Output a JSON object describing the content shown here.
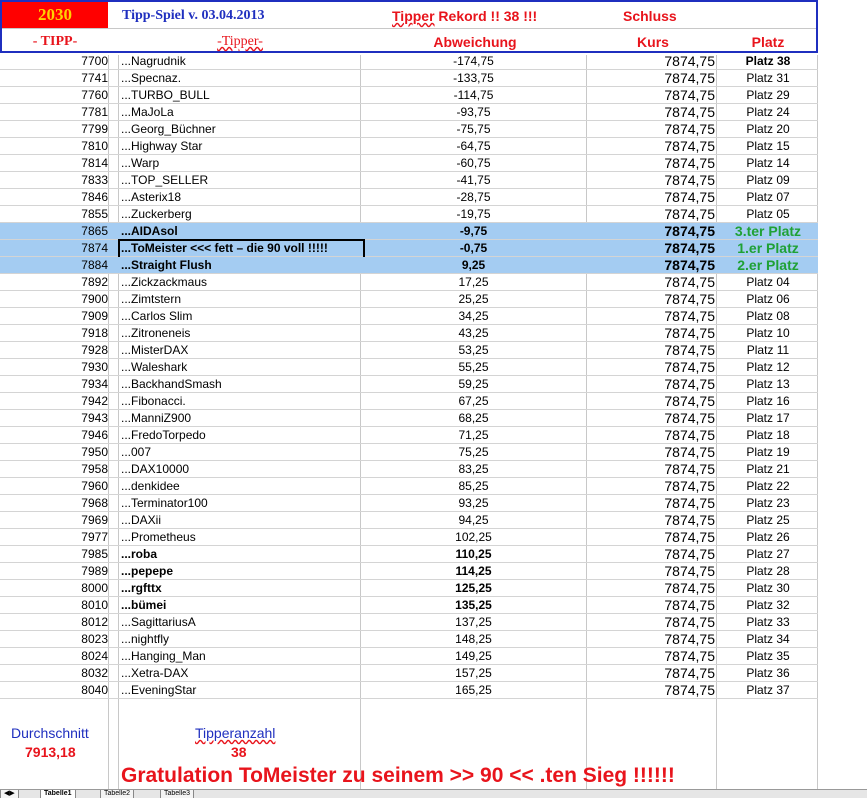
{
  "header": {
    "year": "2030",
    "year_bg": "#ff0000",
    "version": "Tipp-Spiel v. 03.04.2013",
    "rekord_prefix": "Tipper",
    "rekord_rest": "Rekord !!  38  !!!",
    "schluss": "Schluss",
    "col_tipp": "- TIPP-",
    "col_tipper": "-Tipper-",
    "col_abweichung": "Abweichung",
    "col_kurs": "Kurs",
    "col_platz": "Platz",
    "border_color": "#1f2fbf",
    "label_red": "#e8141c",
    "label_blue": "#1f2fbf"
  },
  "rows": [
    {
      "tipp": "7700",
      "name": "...Nagrudnik",
      "dev": "-174,75",
      "kurs": "7874,75",
      "platz": "Platz 38",
      "platz_bold": true
    },
    {
      "tipp": "7741",
      "name": "...Specnaz.",
      "dev": "-133,75",
      "kurs": "7874,75",
      "platz": "Platz 31"
    },
    {
      "tipp": "7760",
      "name": "...TURBO_BULL",
      "dev": "-114,75",
      "kurs": "7874,75",
      "platz": "Platz 29"
    },
    {
      "tipp": "7781",
      "name": "...MaJoLa",
      "dev": "-93,75",
      "kurs": "7874,75",
      "platz": "Platz 24"
    },
    {
      "tipp": "7799",
      "name": "...Georg_Büchner",
      "dev": "-75,75",
      "kurs": "7874,75",
      "platz": "Platz 20"
    },
    {
      "tipp": "7810",
      "name": "...Highway Star",
      "dev": "-64,75",
      "kurs": "7874,75",
      "platz": "Platz 15"
    },
    {
      "tipp": "7814",
      "name": "...Warp",
      "dev": "-60,75",
      "kurs": "7874,75",
      "platz": "Platz 14"
    },
    {
      "tipp": "7833",
      "name": "...TOP_SELLER",
      "dev": "-41,75",
      "kurs": "7874,75",
      "platz": "Platz 09"
    },
    {
      "tipp": "7846",
      "name": "...Asterix18",
      "dev": "-28,75",
      "kurs": "7874,75",
      "platz": "Platz 07"
    },
    {
      "tipp": "7855",
      "name": "...Zuckerberg",
      "dev": "-19,75",
      "kurs": "7874,75",
      "platz": "Platz 05"
    },
    {
      "tipp": "7865",
      "name": "...AIDAsol",
      "dev": "-9,75",
      "kurs": "7874,75",
      "platz": "3.ter Platz",
      "highlight": true,
      "bold": true
    },
    {
      "tipp": "7874",
      "name": "...ToMeister <<< fett – die 90 voll !!!!!",
      "dev": "-0,75",
      "kurs": "7874,75",
      "platz": "1.er Platz",
      "highlight": true,
      "bold": true,
      "selected": true
    },
    {
      "tipp": "7884",
      "name": "...Straight Flush",
      "dev": "9,25",
      "kurs": "7874,75",
      "platz": "2.er Platz",
      "highlight": true,
      "bold": true
    },
    {
      "tipp": "7892",
      "name": "...Zickzackmaus",
      "dev": "17,25",
      "kurs": "7874,75",
      "platz": "Platz 04"
    },
    {
      "tipp": "7900",
      "name": "...Zimtstern",
      "dev": "25,25",
      "kurs": "7874,75",
      "platz": "Platz 06"
    },
    {
      "tipp": "7909",
      "name": "...Carlos Slim",
      "dev": "34,25",
      "kurs": "7874,75",
      "platz": "Platz 08"
    },
    {
      "tipp": "7918",
      "name": "...Zitroneneis",
      "dev": "43,25",
      "kurs": "7874,75",
      "platz": "Platz 10"
    },
    {
      "tipp": "7928",
      "name": "...MisterDAX",
      "dev": "53,25",
      "kurs": "7874,75",
      "platz": "Platz 11"
    },
    {
      "tipp": "7930",
      "name": "...Waleshark",
      "dev": "55,25",
      "kurs": "7874,75",
      "platz": "Platz 12"
    },
    {
      "tipp": "7934",
      "name": "...BackhandSmash",
      "dev": "59,25",
      "kurs": "7874,75",
      "platz": "Platz 13"
    },
    {
      "tipp": "7942",
      "name": "...Fibonacci.",
      "dev": "67,25",
      "kurs": "7874,75",
      "platz": "Platz 16"
    },
    {
      "tipp": "7943",
      "name": "...ManniZ900",
      "dev": "68,25",
      "kurs": "7874,75",
      "platz": "Platz 17"
    },
    {
      "tipp": "7946",
      "name": "...FredoTorpedo",
      "dev": "71,25",
      "kurs": "7874,75",
      "platz": "Platz 18"
    },
    {
      "tipp": "7950",
      "name": "...007",
      "dev": "75,25",
      "kurs": "7874,75",
      "platz": "Platz 19"
    },
    {
      "tipp": "7958",
      "name": "...DAX10000",
      "dev": "83,25",
      "kurs": "7874,75",
      "platz": "Platz 21"
    },
    {
      "tipp": "7960",
      "name": "...denkidee",
      "dev": "85,25",
      "kurs": "7874,75",
      "platz": "Platz 22"
    },
    {
      "tipp": "7968",
      "name": "...Terminator100",
      "dev": "93,25",
      "kurs": "7874,75",
      "platz": "Platz 23"
    },
    {
      "tipp": "7969",
      "name": "...DAXii",
      "dev": "94,25",
      "kurs": "7874,75",
      "platz": "Platz 25"
    },
    {
      "tipp": "7977",
      "name": "...Prometheus",
      "dev": "102,25",
      "kurs": "7874,75",
      "platz": "Platz 26"
    },
    {
      "tipp": "7985",
      "name": "...roba",
      "dev": "110,25",
      "kurs": "7874,75",
      "platz": "Platz 27",
      "bold": true
    },
    {
      "tipp": "7989",
      "name": "...pepepe",
      "dev": "114,25",
      "kurs": "7874,75",
      "platz": "Platz 28",
      "bold": true
    },
    {
      "tipp": "8000",
      "name": "...rgfttx",
      "dev": "125,25",
      "kurs": "7874,75",
      "platz": "Platz 30",
      "bold": true
    },
    {
      "tipp": "8010",
      "name": "...bümei",
      "dev": "135,25",
      "kurs": "7874,75",
      "platz": "Platz 32",
      "bold": true
    },
    {
      "tipp": "8012",
      "name": "...SagittariusA",
      "dev": "137,25",
      "kurs": "7874,75",
      "platz": "Platz 33"
    },
    {
      "tipp": "8023",
      "name": "...nightfly",
      "dev": "148,25",
      "kurs": "7874,75",
      "platz": "Platz 34"
    },
    {
      "tipp": "8024",
      "name": "...Hanging_Man",
      "dev": "149,25",
      "kurs": "7874,75",
      "platz": "Platz 35"
    },
    {
      "tipp": "8032",
      "name": "...Xetra-DAX",
      "dev": "157,25",
      "kurs": "7874,75",
      "platz": "Platz 36"
    },
    {
      "tipp": "8040",
      "name": "...EveningStar",
      "dev": "165,25",
      "kurs": "7874,75",
      "platz": "Platz 37"
    }
  ],
  "footer": {
    "durchschnitt_label": "Durchschnitt",
    "durchschnitt_value": "7913,18",
    "tipperanzahl_label": "Tipperanzahl",
    "tipperanzahl_value": "38",
    "gratulation": "Gratulation ToMeister zu seinem >> 90 << .ten Sieg !!!!!!"
  },
  "tabs": [
    "Tabelle1",
    "Tabelle2",
    "Tabelle3"
  ]
}
